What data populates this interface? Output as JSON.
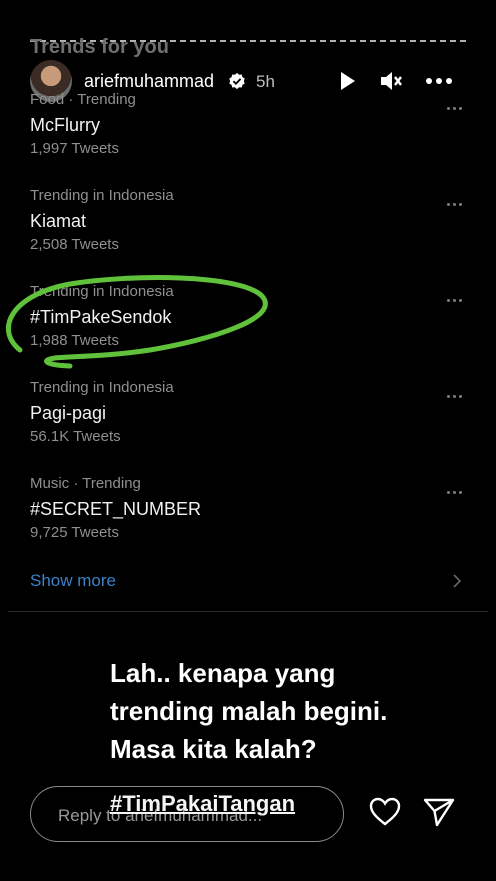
{
  "story": {
    "username": "ariefmuhammad",
    "time": "5h",
    "icons": {
      "verified": "verified-badge-icon",
      "play": "play-icon",
      "mute": "mute-icon",
      "more": "more-icon"
    }
  },
  "trends": {
    "header": "Trends for you",
    "items": [
      {
        "meta": "Food · Trending",
        "name": "McFlurry",
        "count": "1,997 Tweets"
      },
      {
        "meta": "Trending in Indonesia",
        "name": "Kiamat",
        "count": "2,508 Tweets"
      },
      {
        "meta": "Trending in Indonesia",
        "name": "#TimPakeSendok",
        "count": "1,988 Tweets"
      },
      {
        "meta": "Trending in Indonesia",
        "name": "Pagi-pagi",
        "count": "56.1K Tweets"
      },
      {
        "meta": "Music · Trending",
        "name": "#SECRET_NUMBER",
        "count": "9,725 Tweets"
      }
    ],
    "show_more": "Show more",
    "highlight_color": "#5fc23a",
    "link_color": "#3b82c7"
  },
  "caption": {
    "lines": [
      "Lah.. kenapa yang",
      "trending malah begini.",
      "Masa kita kalah?"
    ],
    "hashtag": "#TimPakaiTangan"
  },
  "reply": {
    "placeholder": "Reply to ariefmuhammad..."
  }
}
